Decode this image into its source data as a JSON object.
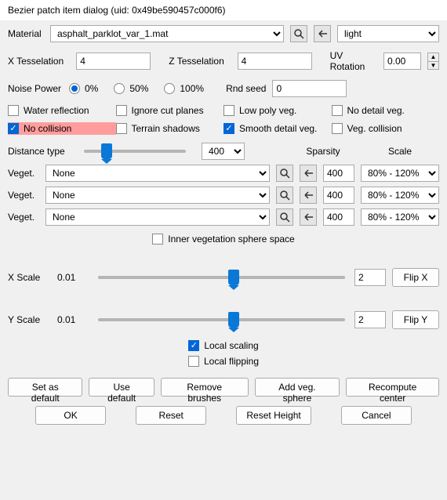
{
  "title": "Bezier patch item dialog (uid: 0x49be590457c000f6)",
  "material": {
    "label": "Material",
    "value": "asphalt_parklot_var_1.mat",
    "preset": "light"
  },
  "tess": {
    "x_label": "X Tesselation",
    "x_value": "4",
    "z_label": "Z Tesselation",
    "z_value": "4",
    "uv_label": "UV Rotation",
    "uv_value": "0.00"
  },
  "noise": {
    "label": "Noise Power",
    "opt0": "0%",
    "opt50": "50%",
    "opt100": "100%",
    "seed_label": "Rnd seed",
    "seed_value": "0"
  },
  "checks": {
    "water": "Water reflection",
    "ignore_cut": "Ignore cut planes",
    "low_poly": "Low poly veg.",
    "no_detail": "No detail veg.",
    "no_collision": "No collision",
    "terrain_shadows": "Terrain shadows",
    "smooth_detail": "Smooth detail veg.",
    "veg_collision": "Veg. collision"
  },
  "distance": {
    "label": "Distance type",
    "value": "400",
    "sparsity": "Sparsity",
    "scale": "Scale"
  },
  "veget": {
    "label": "Veget.",
    "rows": [
      {
        "value": "None",
        "sparsity": "400",
        "scale": "80% - 120%"
      },
      {
        "value": "None",
        "sparsity": "400",
        "scale": "80% - 120%"
      },
      {
        "value": "None",
        "sparsity": "400",
        "scale": "80% - 120%"
      }
    ],
    "inner": "Inner vegetation sphere space"
  },
  "scale": {
    "x_label": "X Scale",
    "x_min": "0.01",
    "x_val": "2",
    "flip_x": "Flip X",
    "y_label": "Y Scale",
    "y_min": "0.01",
    "y_val": "2",
    "flip_y": "Flip Y",
    "local_scaling": "Local scaling",
    "local_flipping": "Local flipping"
  },
  "buttons": {
    "set_default": "Set as default",
    "use_default": "Use default",
    "remove_brushes": "Remove brushes",
    "add_veg": "Add veg. sphere",
    "recompute": "Recompute center",
    "ok": "OK",
    "reset": "Reset",
    "reset_height": "Reset Height",
    "cancel": "Cancel"
  }
}
